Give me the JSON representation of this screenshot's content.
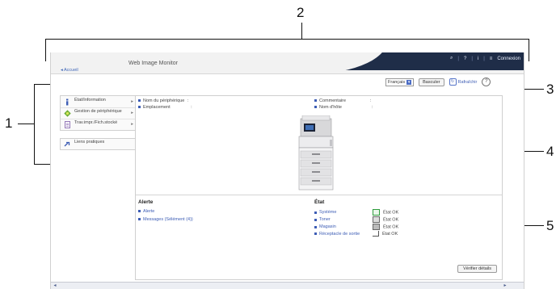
{
  "callouts": [
    "1",
    "2",
    "3",
    "4",
    "5"
  ],
  "header": {
    "title": "Web Image Monitor",
    "search_icon": "search-icon",
    "help_label": "?",
    "info_label": "i",
    "connexion_label": "Connexion"
  },
  "breadcrumb": "Accueil",
  "toolbar": {
    "language": "Français",
    "switch_label": "Basculer",
    "refresh_label": "Rafraîchir",
    "help_label": "?"
  },
  "sidebar": {
    "items": [
      {
        "label": "État/Information"
      },
      {
        "label": "Gestion de périphérique"
      },
      {
        "label": "Trav.impr./Fich.stocké"
      }
    ],
    "links_label": "Liens pratiques"
  },
  "device": {
    "fields": [
      {
        "label": "Nom du périphérique",
        "sep": ":",
        "value": ""
      },
      {
        "label": "Emplacement",
        "sep": ":",
        "value": ""
      },
      {
        "label": "Commentaire",
        "sep": ":",
        "value": ""
      },
      {
        "label": "Nom d'hôte",
        "sep": ":",
        "value": ""
      }
    ]
  },
  "alerts": {
    "title": "Alerte",
    "items": [
      "Alerte",
      "Messages (Sélément (4))"
    ]
  },
  "status": {
    "title": "État",
    "items": [
      {
        "label": "Système",
        "value": "État OK"
      },
      {
        "label": "Toner",
        "value": "État OK"
      },
      {
        "label": "Magasin",
        "value": "État OK"
      },
      {
        "label": "Réceptacle de sortie",
        "value": "État OK"
      }
    ],
    "check_button": "Vérifier détails"
  },
  "colors": {
    "header_dark": "#1f2d48",
    "link_blue": "#3d5db5",
    "ok_green": "#2e9b3c"
  }
}
